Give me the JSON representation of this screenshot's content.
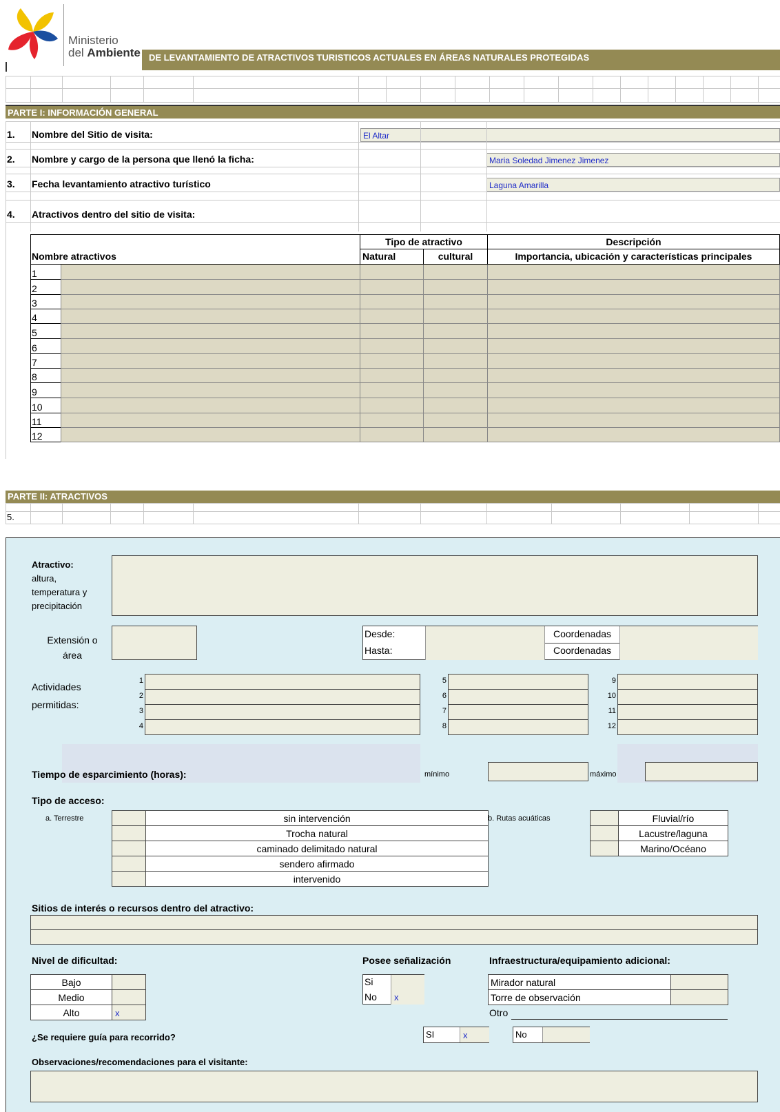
{
  "header": {
    "org_line1": "Ministerio",
    "org_line2a": "del ",
    "org_line2b": "Ambiente",
    "title": "DE LEVANTAMIENTO DE ATRACTIVOS TURISTICOS ACTUALES  EN ÁREAS NATURALES PROTEGIDAS"
  },
  "colors": {
    "band": "#948a54",
    "entry": "#eeeee0",
    "table_fill": "#ddd9c4",
    "section_bg": "#dbeef3",
    "value_text": "#1f2cc8"
  },
  "part1": {
    "title": "PARTE I:  INFORMACIÓN GENERAL",
    "q1_num": "1.",
    "q1_label": "Nombre del  Sitio de visita:",
    "q1_value": "El Altar",
    "q2_num": "2.",
    "q2_label": "Nombre y cargo de la persona que llenó la ficha:",
    "q2_value": "Maria Soledad Jimenez Jimenez",
    "q3_num": "3.",
    "q3_label": "Fecha levantamiento  atractivo turístico",
    "q3_value": "Laguna Amarilla",
    "q4_num": "4.",
    "q4_label": "Atractivos dentro del  sitio de visita:",
    "table": {
      "col_name": "Nombre atractivos",
      "col_tipo": "Tipo de atractivo",
      "col_natural": "Natural",
      "col_cultural": "cultural",
      "col_desc": "Descripción",
      "col_desc_sub": "Importancia, ubicación  y características principales",
      "rows": [
        "1",
        "2",
        "3",
        "4",
        "5",
        "6",
        "7",
        "8",
        "9",
        "10",
        "11",
        "12"
      ]
    }
  },
  "part2": {
    "title": "PARTE  II: ATRACTIVOS",
    "num": "5.",
    "atractivo_label": "Atractivo:",
    "atractivo_sub": "altura,",
    "atractivo_sub2": "temperatura y",
    "atractivo_sub3": "precipitación",
    "ext_label1": "Extensión o",
    "ext_label2": "área",
    "desde": "Desde:",
    "hasta": "Hasta:",
    "coord1": "Coordenadas",
    "coord2": "Coordenadas",
    "act_label1": "Actividades",
    "act_label2": "permitidas:",
    "act_nums": [
      "1",
      "2",
      "3",
      "4",
      "5",
      "6",
      "7",
      "8",
      "9",
      "10",
      "11",
      "12"
    ],
    "tiempo_label": "Tiempo de esparcimiento (horas):",
    "minimo": "mínimo",
    "maximo": "máximo",
    "acceso_label": "Tipo de acceso:",
    "terrestre": "a. Terrestre",
    "terrestre_opts": [
      "sin intervención",
      "Trocha natural",
      "caminado delimitado natural",
      "sendero afirmado",
      "intervenido"
    ],
    "acuaticas": "b. Rutas acuáticas",
    "acuaticas_opts": [
      "Fluvial/río",
      "Lacustre/laguna",
      "Marino/Océano"
    ],
    "sitios_label": "Sitios de interés o recursos  dentro del atractivo:",
    "dificultad_label": "Nivel de dificultad:",
    "dificultad_opts": [
      "Bajo",
      "Medio",
      "Alto"
    ],
    "dificultad_mark": "x",
    "senal_label": "Posee señalización",
    "senal_si": "Si",
    "senal_no": "No",
    "senal_mark": "x",
    "infra_label": "Infraestructura/equipamiento adicional:",
    "infra_opts": [
      "Mirador natural",
      "Torre de observación"
    ],
    "infra_otro": "Otro",
    "guia_label": "¿Se requiere guía para recorrido?",
    "guia_si": "SI",
    "guia_mark": "x",
    "guia_no": "No",
    "obs_label": "Observaciones/recomendaciones para el visitante:"
  }
}
